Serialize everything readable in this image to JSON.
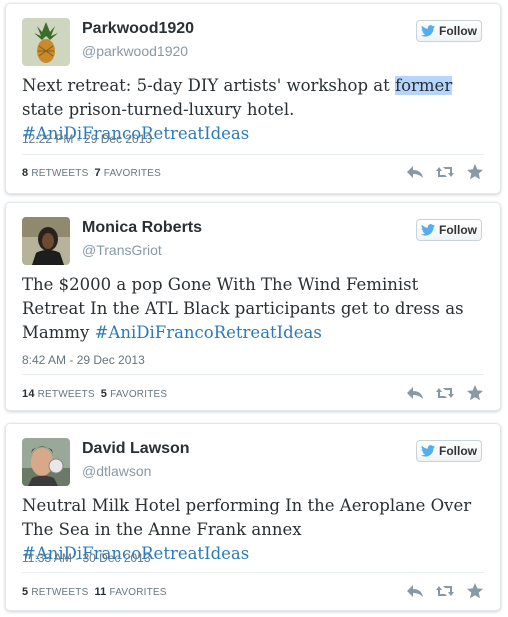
{
  "follow_label": "Follow",
  "retweets_label": "RETWEETS",
  "favorites_label": "FAVORITES",
  "tweets": [
    {
      "name": "Parkwood1920",
      "handle": "@parkwood1920",
      "text_before": "Next retreat: 5-day DIY artists' workshop at ",
      "text_highlight": "former",
      "text_after": " state prison-turned-luxury hotel. ",
      "hashtag": "#AniDiFrancoRetreatIdeas",
      "time": "12:22 PM - 29 Dec 2013",
      "retweets": "8",
      "favorites": "7"
    },
    {
      "name": "Monica Roberts",
      "handle": "@TransGriot",
      "text_before": "The $2000 a pop Gone With The Wind Feminist Retreat In the ATL  Black participants get to dress as Mammy ",
      "text_highlight": "",
      "text_after": "",
      "hashtag": "#AniDiFrancoRetreatIdeas",
      "time": "8:42 AM - 29 Dec 2013",
      "retweets": "14",
      "favorites": "5"
    },
    {
      "name": "David Lawson",
      "handle": "@dtlawson",
      "text_before": "Neutral Milk Hotel performing In the Aeroplane Over The Sea in the Anne Frank annex ",
      "text_highlight": "",
      "text_after": "",
      "hashtag": "#AniDiFrancoRetreatIdeas",
      "time": "11:33 AM - 30 Dec 2013",
      "retweets": "5",
      "favorites": "11"
    }
  ],
  "colors": {
    "hashtag": "#2b7bb9",
    "twitter_bird": "#55acee",
    "meta": "#66757f"
  }
}
